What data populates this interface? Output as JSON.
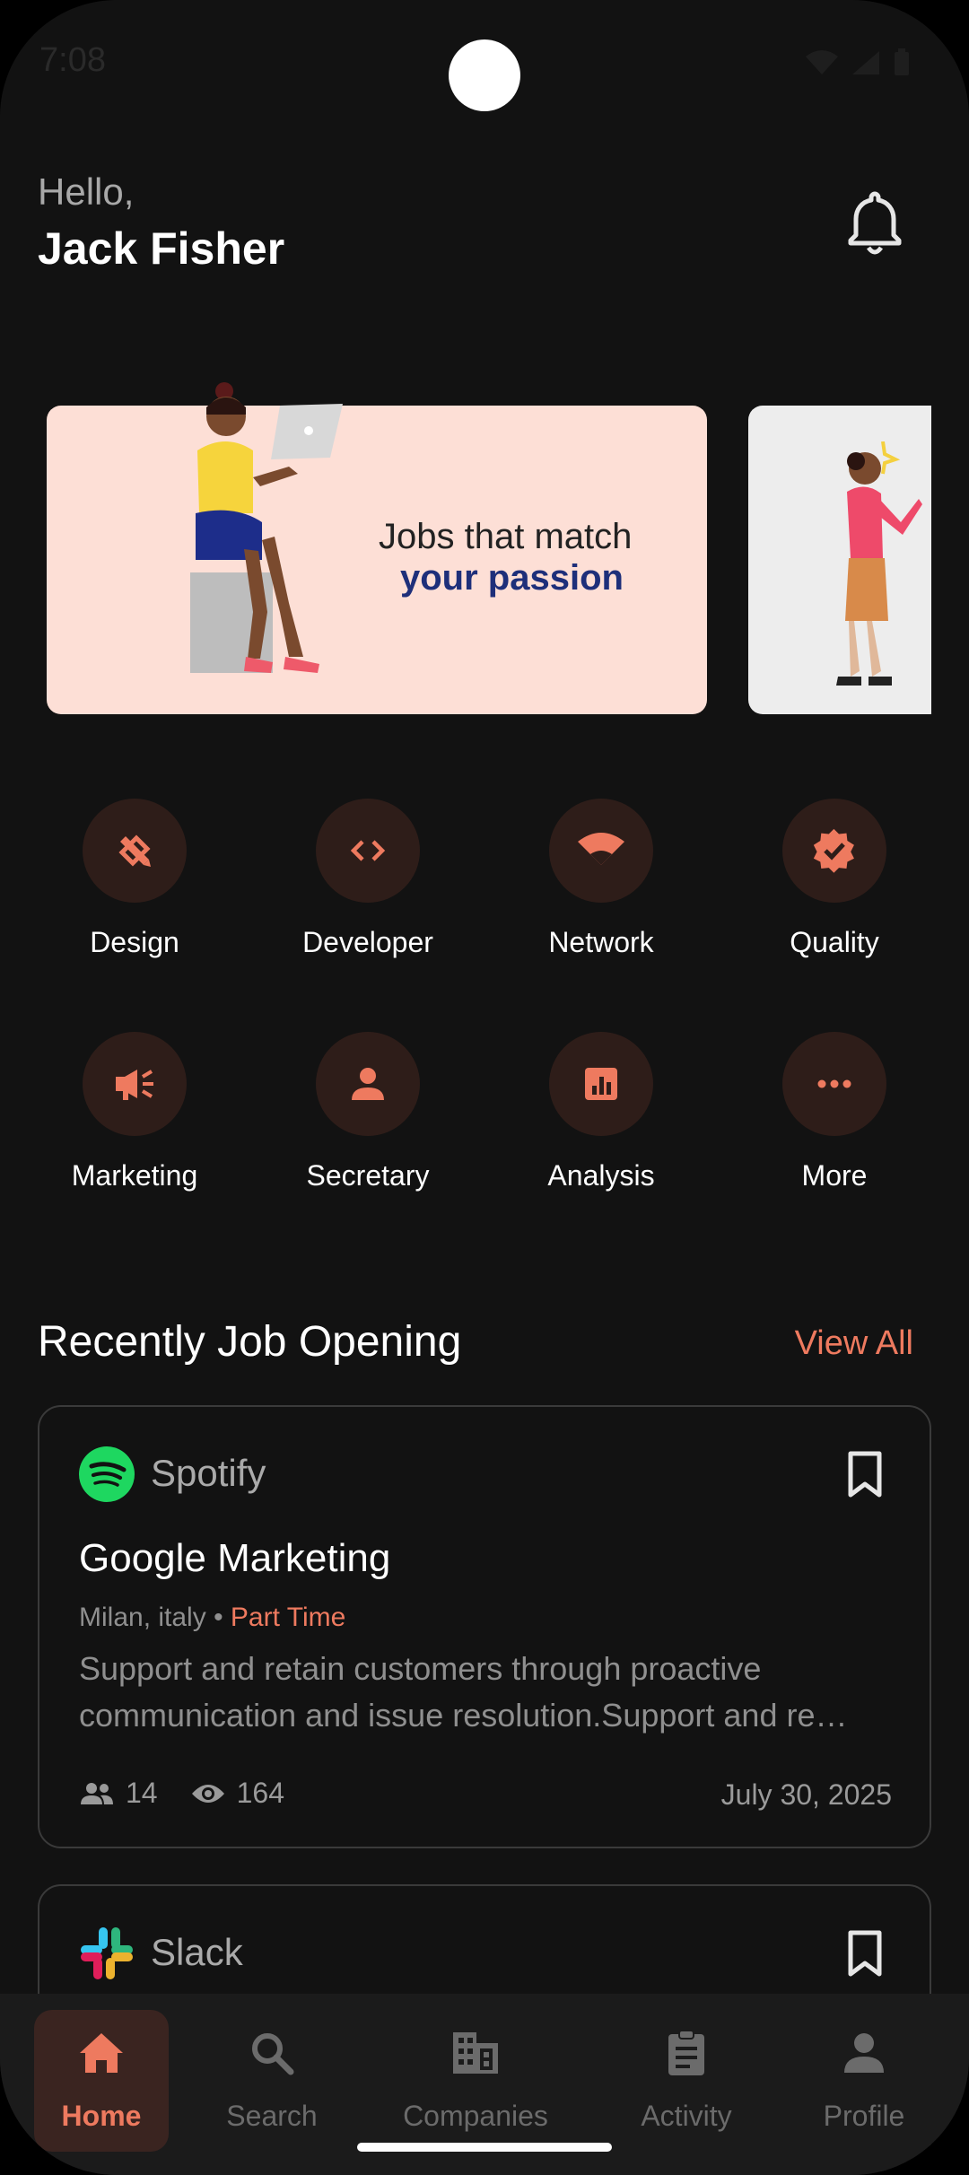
{
  "status_bar": {
    "time": "7:08"
  },
  "header": {
    "greeting": "Hello,",
    "user_name": "Jack Fisher"
  },
  "banner": {
    "line1": "Jobs that match",
    "line2": "your passion"
  },
  "categories": [
    {
      "label": "Design",
      "icon": "pencil-ruler-icon"
    },
    {
      "label": "Developer",
      "icon": "code-icon"
    },
    {
      "label": "Network",
      "icon": "wifi-icon"
    },
    {
      "label": "Quality",
      "icon": "verified-badge-icon"
    },
    {
      "label": "Marketing",
      "icon": "megaphone-icon"
    },
    {
      "label": "Secretary",
      "icon": "person-icon"
    },
    {
      "label": "Analysis",
      "icon": "bar-chart-icon"
    },
    {
      "label": "More",
      "icon": "more-horizontal-icon"
    }
  ],
  "recent_jobs": {
    "title": "Recently Job Opening",
    "view_all": "View All",
    "jobs": [
      {
        "company": "Spotify",
        "title": "Google Marketing",
        "location": "Milan, italy",
        "separator": "•",
        "type": "Part Time",
        "description": "Support and retain customers through proactive communication and issue resolution.Support and re…",
        "applicants": "14",
        "views": "164",
        "date": "July 30, 2025"
      },
      {
        "company": "Slack"
      }
    ]
  },
  "bottom_nav": [
    {
      "label": "Home",
      "icon": "home-icon",
      "active": true
    },
    {
      "label": "Search",
      "icon": "search-icon"
    },
    {
      "label": "Companies",
      "icon": "building-icon"
    },
    {
      "label": "Activity",
      "icon": "clipboard-icon"
    },
    {
      "label": "Profile",
      "icon": "person-icon"
    }
  ],
  "colors": {
    "accent": "#ee7a5f",
    "background": "#121212",
    "category_bg": "#2e1d19",
    "banner_bg": "#fddfd6",
    "banner_highlight": "#1e2f7a"
  }
}
